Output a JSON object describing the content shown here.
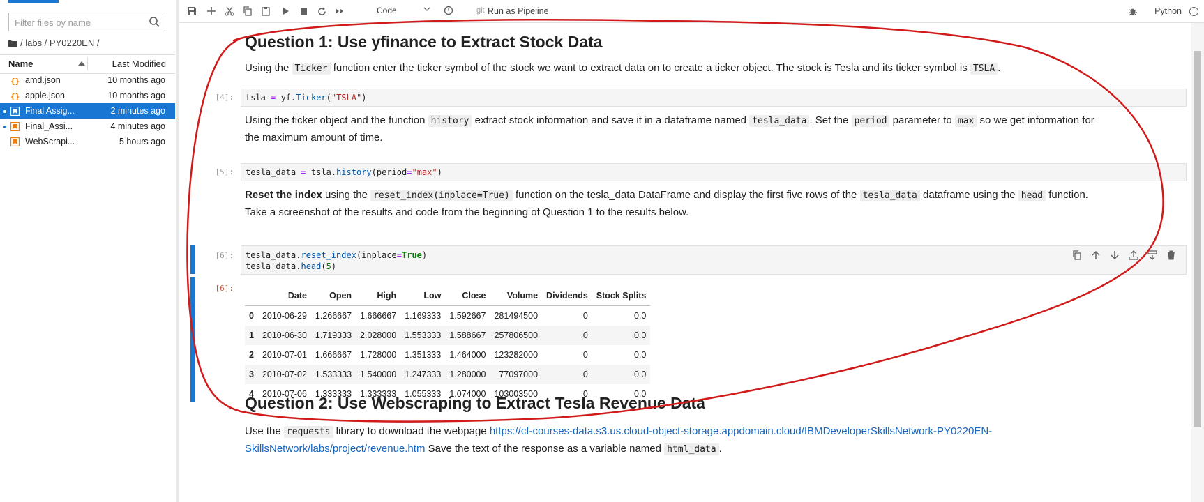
{
  "sidebar": {
    "filter_placeholder": "Filter files by name",
    "breadcrumb": "/ labs / PY0220EN /",
    "header": {
      "name": "Name",
      "modified": "Last Modified"
    },
    "files": [
      {
        "name": "amd.json",
        "modified": "10 months ago",
        "icon": "json-icon",
        "selected": false,
        "running": false
      },
      {
        "name": "apple.json",
        "modified": "10 months ago",
        "icon": "json-icon",
        "selected": false,
        "running": false
      },
      {
        "name": "Final Assig...",
        "modified": "2 minutes ago",
        "icon": "notebook-icon",
        "selected": true,
        "running": true
      },
      {
        "name": "Final_Assi...",
        "modified": "4 minutes ago",
        "icon": "notebook-icon",
        "selected": false,
        "running": true
      },
      {
        "name": "WebScrapi...",
        "modified": "5 hours ago",
        "icon": "notebook-icon",
        "selected": false,
        "running": false
      }
    ]
  },
  "toolbar": {
    "icons": [
      "save-icon",
      "add-cell-icon",
      "cut-icon",
      "copy-icon",
      "paste-icon",
      "run-icon",
      "stop-icon",
      "restart-icon",
      "fast-forward-icon"
    ],
    "cell_type": "Code",
    "git": "git",
    "run_pipeline": "Run as Pipeline",
    "kernel": "Python"
  },
  "notebook": {
    "q1_heading": "Question 1: Use yfinance to Extract Stock Data",
    "p1": {
      "a": "Using the",
      "code1": "Ticker",
      "b": "function enter the ticker symbol of the stock we want to extract data on to create a ticker object. The stock is Tesla and its ticker symbol is",
      "code2": "TSLA",
      "c": "."
    },
    "cell4": {
      "prompt": "[4]:",
      "code": "tsla = yf.Ticker(\"TSLA\")"
    },
    "p2": {
      "a": "Using the ticker object and the function",
      "code1": "history",
      "b": "extract stock information and save it in a dataframe named",
      "code2": "tesla_data",
      "c": ". Set the",
      "code3": "period",
      "d": "parameter to",
      "code4": "max",
      "e": "so we get information for",
      "f": "the maximum amount of time."
    },
    "cell5": {
      "prompt": "[5]:",
      "code": "tesla_data = tsla.history(period=\"max\")"
    },
    "p3": {
      "bold": "Reset the index",
      "a": "using the",
      "code1": "reset_index(inplace=True)",
      "b": "function on the tesla_data DataFrame and display the first five rows of the",
      "code2": "tesla_data",
      "c": "dataframe using the",
      "code3": "head",
      "d": "function.",
      "e": "Take a screenshot of the results and code from the beginning of Question 1 to the results below."
    },
    "cell6": {
      "prompt": "[6]:",
      "line1": "tesla_data.reset_index(inplace=True)",
      "line2": "tesla_data.head(5)"
    },
    "out6": {
      "prompt": "[6]:",
      "columns": [
        "",
        "Date",
        "Open",
        "High",
        "Low",
        "Close",
        "Volume",
        "Dividends",
        "Stock Splits"
      ],
      "rows": [
        [
          "0",
          "2010-06-29",
          "1.266667",
          "1.666667",
          "1.169333",
          "1.592667",
          "281494500",
          "0",
          "0.0"
        ],
        [
          "1",
          "2010-06-30",
          "1.719333",
          "2.028000",
          "1.553333",
          "1.588667",
          "257806500",
          "0",
          "0.0"
        ],
        [
          "2",
          "2010-07-01",
          "1.666667",
          "1.728000",
          "1.351333",
          "1.464000",
          "123282000",
          "0",
          "0.0"
        ],
        [
          "3",
          "2010-07-02",
          "1.533333",
          "1.540000",
          "1.247333",
          "1.280000",
          "77097000",
          "0",
          "0.0"
        ],
        [
          "4",
          "2010-07-06",
          "1.333333",
          "1.333333",
          "1.055333",
          "1.074000",
          "103003500",
          "0",
          "0.0"
        ]
      ]
    },
    "q2_heading": "Question 2: Use Webscraping to Extract Tesla Revenue Data",
    "p4": {
      "a": "Use the",
      "code1": "requests",
      "b": "library to download the webpage",
      "link1": "https://cf-courses-data.s3.us.cloud-object-storage.appdomain.cloud/IBMDeveloperSkillsNetwork-PY0220EN-",
      "link2": "SkillsNetwork/labs/project/revenue.htm",
      "c": "Save the text of the response as a variable named",
      "code2": "html_data",
      "d": "."
    }
  },
  "colors": {
    "accent": "#1976d2",
    "annotation": "#d11a1a"
  }
}
